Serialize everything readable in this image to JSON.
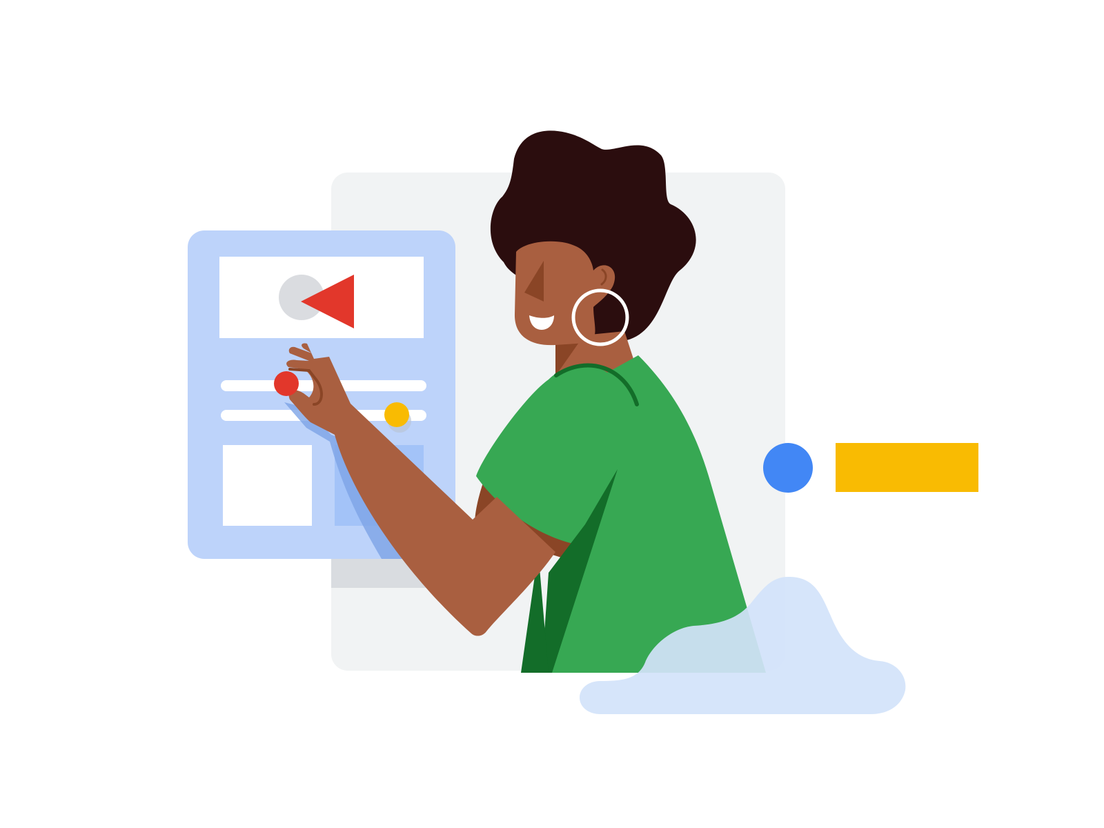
{
  "illustration": {
    "subject": "",
    "colors": {
      "background": "#ffffff",
      "back_panel": "#f1f3f4",
      "back_panel_shadow": "#d9dce0",
      "front_card": "#bdd3fa",
      "front_card_accent": "#8ab4f8",
      "card_white": "#ffffff",
      "player_circle": "#dadce0",
      "play_triangle": "#e2372b",
      "slider_red": "#e2372b",
      "slider_yellow": "#f9bb02",
      "skin": "#a95f40",
      "skin_shadow": "#8a4526",
      "hair": "#2b0d0e",
      "shirt": "#37a853",
      "shirt_dark": "#136d29",
      "earring": "#ffffff",
      "blue_dot": "#4287f5",
      "yellow_bar": "#f9bb02",
      "cloud": "#d3e3fa"
    },
    "icons": [
      "play-icon",
      "slider-handle",
      "hoop-earring"
    ]
  }
}
